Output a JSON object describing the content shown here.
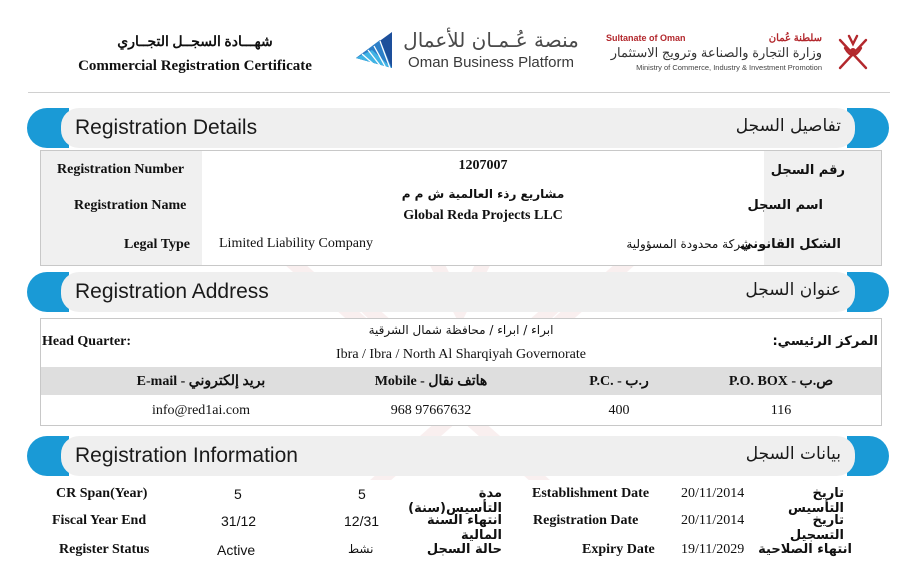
{
  "header": {
    "certificate_ar": "شهـــادة السجــل التجــاري",
    "certificate_en": "Commercial Registration Certificate",
    "platform_ar": "منصة عُـمـان للأعمال",
    "platform_en": "Oman Business Platform",
    "sultanate_en": "Sultanate of Oman",
    "sultanate_ar": "سلطنة عُمان",
    "ministry_ar": "وزارة التجارة والصناعة وترويج الاستثمار",
    "ministry_en": "Ministry of Commerce, Industry & Investment Promotion",
    "brand_color": "#1a9ad6",
    "ministry_color": "#b3282d"
  },
  "details": {
    "title_en": "Registration Details",
    "title_ar": "تفاصيل السجل",
    "reg_number_label_en": "Registration Number",
    "reg_number_label_ar": "رقم السجل",
    "reg_number": "1207007",
    "reg_name_label_en": "Registration Name",
    "reg_name_label_ar": "اسم السجل",
    "reg_name_ar": "مشاريع رذء العالمية ش م م",
    "reg_name_en": "Global Reda Projects LLC",
    "legal_type_label_en": "Legal Type",
    "legal_type_label_ar": "الشكل القانوني",
    "legal_type_en": "Limited Liability Company",
    "legal_type_ar": "شركة محدودة المسؤولية"
  },
  "address": {
    "title_en": "Registration Address",
    "title_ar": "عنوان السجل",
    "hq_label_en": "Head Quarter:",
    "hq_label_ar": "المركز الرئيسي:",
    "hq_ar": "ابراء / ابراء / محافظة شمال الشرقية",
    "hq_en": "Ibra / Ibra / North Al Sharqiyah Governorate",
    "col_email": "E-mail - بريد إلكتروني",
    "col_mobile": "Mobile - هاتف نقال",
    "col_pc": "P.C. - ر.ب",
    "col_pobox": "P.O. BOX - ص.ب",
    "email": "info@red1ai.com",
    "mobile": "968 97667632",
    "pc": "400",
    "pobox": "116"
  },
  "info": {
    "title_en": "Registration Information",
    "title_ar": "بيانات السجل",
    "cr_span_label_en": "CR Span(Year)",
    "cr_span_en": "5",
    "cr_span_ar": "5",
    "cr_span_label_ar": "مدة التأسيس(سنة)",
    "fiscal_label_en": "Fiscal Year End",
    "fiscal_en": "31/12",
    "fiscal_ar": "12/31",
    "fiscal_label_ar": "انتهاء السنة المالية",
    "status_label_en": "Register Status",
    "status_en": "Active",
    "status_ar": "نشط",
    "status_label_ar": "حالة السجل",
    "est_label_en": "Establishment Date",
    "est_date": "20/11/2014",
    "est_label_ar": "تاريخ التأسيس",
    "reg_label_en": "Registration Date",
    "reg_date": "20/11/2014",
    "reg_label_ar": "تاريخ التسجيل",
    "exp_label_en": "Expiry Date",
    "exp_date": "19/11/2029",
    "exp_label_ar": "انتهاء الصلاحية"
  }
}
